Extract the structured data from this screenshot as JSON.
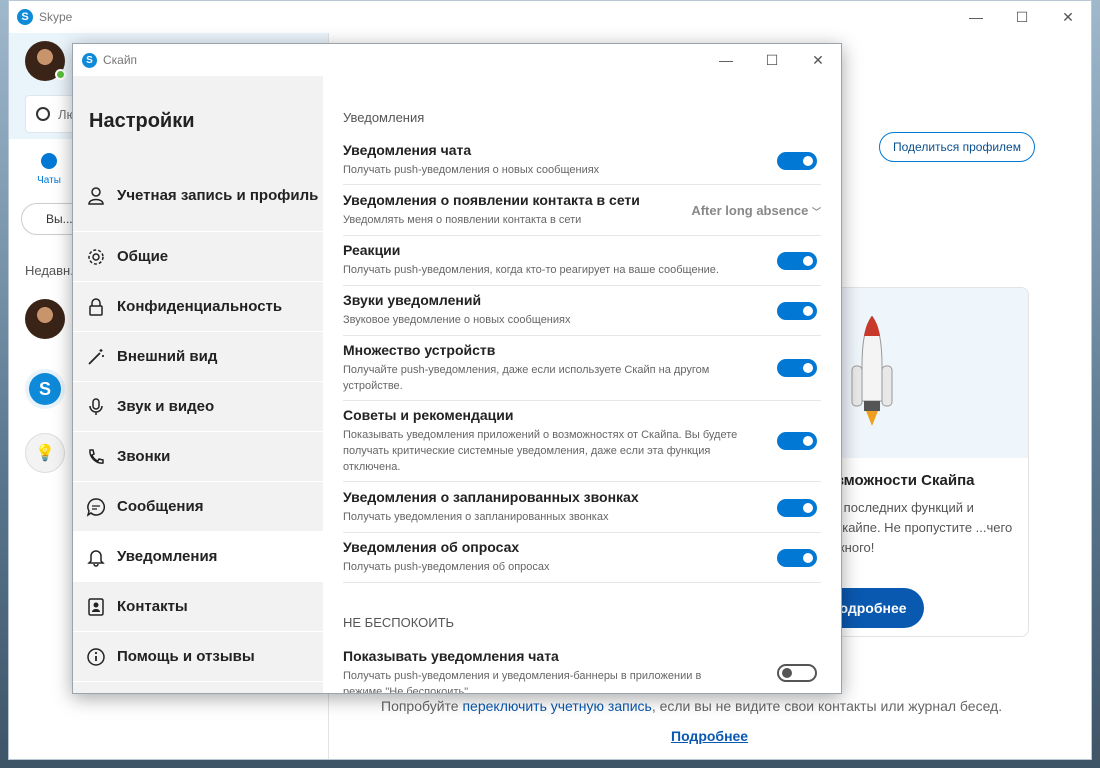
{
  "main_window": {
    "title": "Skype",
    "search_placeholder": "Лю... инт...",
    "chat_tab": "Чаты",
    "call_button": "Вы...",
    "recent_label": "Недавн...",
    "share_button": "Поделиться профилем",
    "promo": {
      "title": "...зможности Скайпа",
      "desc": "...е последних функций и ...Скайпе. Не пропустите ...чего важного!",
      "button": "Подробнее"
    },
    "hint_pre": "Попробуйте ",
    "hint_link": "переключить учетную запись",
    "hint_post": ", если вы не видите свои контакты или журнал бесед.",
    "more_link": "Подробнее"
  },
  "dialog": {
    "title": "Скайп",
    "heading": "Настройки",
    "nav": [
      {
        "label": "Учетная запись и профиль",
        "icon": "person-icon"
      },
      {
        "label": "Общие",
        "icon": "gear-icon"
      },
      {
        "label": "Конфиденциальность",
        "icon": "lock-icon"
      },
      {
        "label": "Внешний вид",
        "icon": "magic-wand-icon"
      },
      {
        "label": "Звук и видео",
        "icon": "microphone-icon"
      },
      {
        "label": "Звонки",
        "icon": "phone-icon"
      },
      {
        "label": "Сообщения",
        "icon": "chat-icon"
      },
      {
        "label": "Уведомления",
        "icon": "bell-icon"
      },
      {
        "label": "Контакты",
        "icon": "contacts-icon"
      },
      {
        "label": "Помощь и отзывы",
        "icon": "info-icon"
      }
    ],
    "active_nav": "Уведомления",
    "section1": "Уведомления",
    "rows": [
      {
        "title": "Уведомления чата",
        "desc": "Получать push-уведомления о новых сообщениях",
        "on": true
      },
      {
        "title": "Уведомления о появлении контакта в сети",
        "desc": "Уведомлять меня о появлении контакта в сети",
        "dropdown": "After long absence"
      },
      {
        "title": "Реакции",
        "desc": "Получать push-уведомления, когда кто-то реагирует на ваше сообщение.",
        "on": true
      },
      {
        "title": "Звуки уведомлений",
        "desc": "Звуковое уведомление о новых сообщениях",
        "on": true
      },
      {
        "title": "Множество устройств",
        "desc": "Получайте push-уведомления, даже если используете Скайп на другом устройстве.",
        "on": true
      },
      {
        "title": "Советы и рекомендации",
        "desc": "Показывать уведомления приложений о возможностях от Скайпа. Вы будете получать критические системные уведомления, даже если эта функция отключена.",
        "on": true
      },
      {
        "title": "Уведомления о запланированных звонках",
        "desc": "Получать уведомления о запланированных звонках",
        "on": true
      },
      {
        "title": "Уведомления об опросах",
        "desc": "Получать push-уведомления об опросах",
        "on": true
      }
    ],
    "section2": "НЕ БЕСПОКОИТЬ",
    "dnd_row": {
      "title": "Показывать уведомления чата",
      "desc": "Получать push-уведомления и уведомления-баннеры в приложении в режиме \"Не беспокоить\"",
      "on": false
    },
    "colors": {
      "accent": "#0078d4",
      "sidebar_bg": "#f2f2f2"
    }
  }
}
